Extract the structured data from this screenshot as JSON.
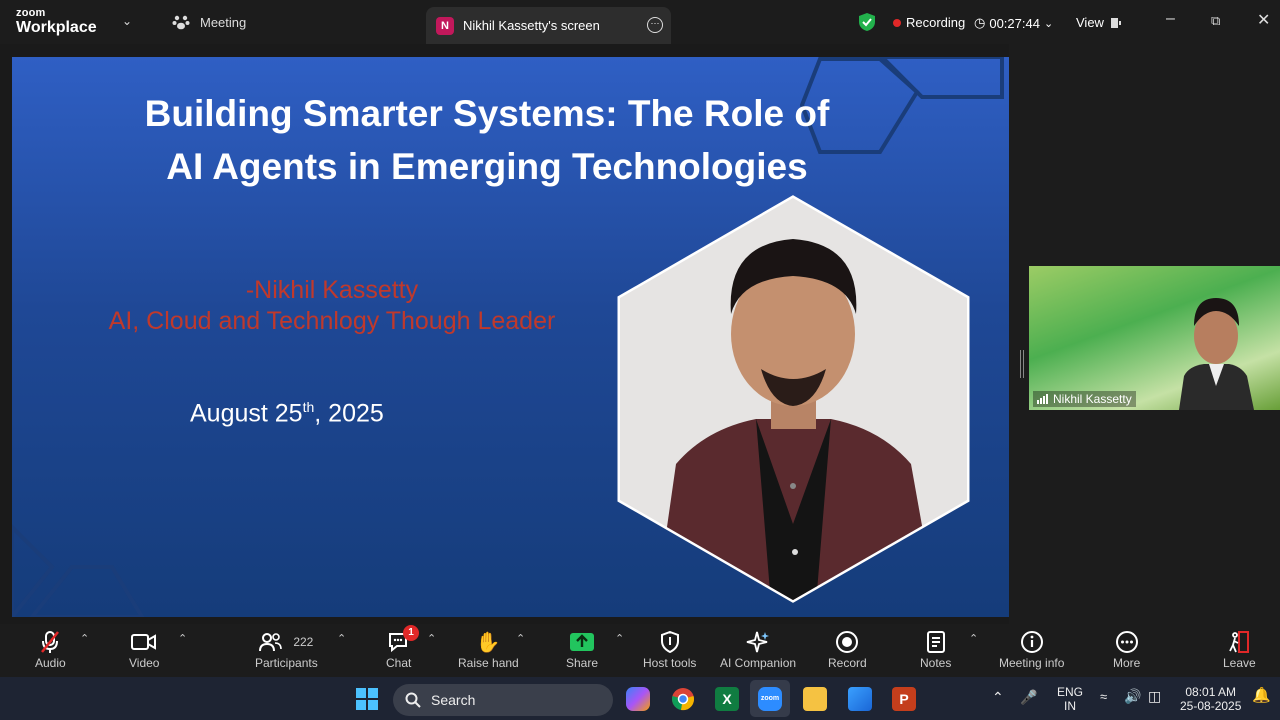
{
  "app": {
    "logo_line1": "zoom",
    "logo_line2": "Workplace"
  },
  "header": {
    "meeting_label": "Meeting",
    "tab_avatar": "N",
    "tab_title": "Nikhil Kassetty's screen",
    "recording_label": "Recording",
    "timer": "00:27:44",
    "view_label": "View"
  },
  "slide": {
    "title_line1": "Building Smarter Systems: The Role of",
    "title_line2": "AI Agents in Emerging Technologies",
    "author_line1": "-Nikhil Kassetty",
    "author_line2": "AI, Cloud and Technlogy Though Leader",
    "date_prefix": "August 25",
    "date_sup": "th",
    "date_suffix": ", 2025"
  },
  "participant_video": {
    "name": "Nikhil Kassetty"
  },
  "toolbar": {
    "audio": "Audio",
    "video": "Video",
    "participants": "Participants",
    "participants_count": "222",
    "chat": "Chat",
    "chat_badge": "1",
    "raise_hand": "Raise hand",
    "share": "Share",
    "host_tools": "Host tools",
    "ai_companion": "AI Companion",
    "record": "Record",
    "notes": "Notes",
    "meeting_info": "Meeting info",
    "more": "More",
    "leave": "Leave"
  },
  "taskbar": {
    "search_label": "Search",
    "lang1": "ENG",
    "lang2": "IN",
    "time": "08:01 AM",
    "date": "25-08-2025"
  },
  "colors": {
    "accent_red": "#e02828",
    "slide_blue": "#1f4896",
    "author_red": "#c0392b"
  }
}
